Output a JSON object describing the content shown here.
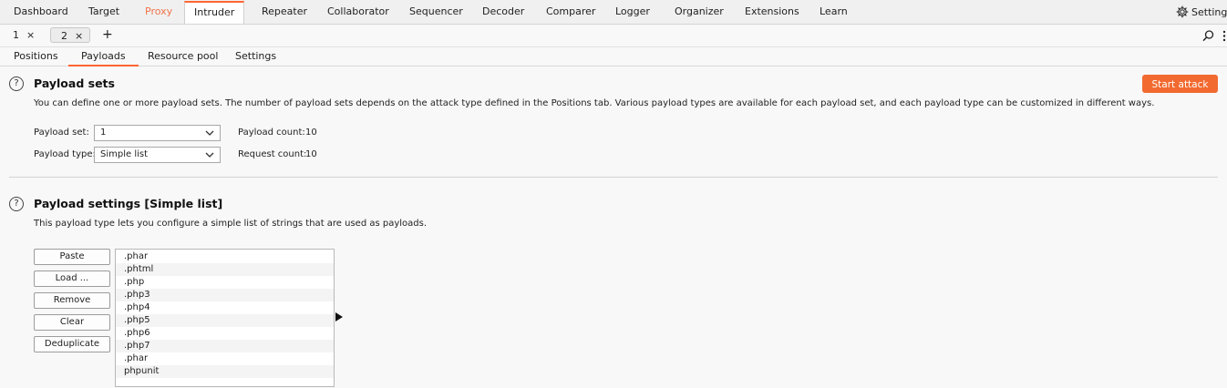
{
  "nav": {
    "tabs": [
      "Dashboard",
      "Target",
      "Proxy",
      "Intruder",
      "Repeater",
      "Collaborator",
      "Sequencer",
      "Decoder",
      "Comparer",
      "Logger",
      "Organizer",
      "Extensions",
      "Learn"
    ],
    "settings_label": "Settings",
    "accent": "#ff6633"
  },
  "instance_tabs": [
    {
      "label": "1",
      "close": "×"
    },
    {
      "label": "2",
      "close": "×"
    }
  ],
  "add_tab": "+",
  "sub_tabs": [
    "Positions",
    "Payloads",
    "Resource pool",
    "Settings"
  ],
  "payload_sets": {
    "title": "Payload sets",
    "description": "You can define one or more payload sets. The number of payload sets depends on the attack type defined in the Positions tab. Various payload types are available for each payload set, and each payload type can be customized in different ways.",
    "start_attack": "Start attack",
    "payload_set_label": "Payload set:",
    "payload_set_value": "1",
    "payload_type_label": "Payload type:",
    "payload_type_value": "Simple list",
    "payload_count_label": "Payload count:",
    "payload_count_value": "10",
    "request_count_label": "Request count:",
    "request_count_value": "10"
  },
  "payload_settings": {
    "title": "Payload settings [Simple list]",
    "description": "This payload type lets you configure a simple list of strings that are used as payloads.",
    "buttons": [
      "Paste",
      "Load ...",
      "Remove",
      "Clear",
      "Deduplicate"
    ],
    "items": [
      ".phar",
      ".phtml",
      ".php",
      ".php3",
      ".php4",
      ".php5",
      ".php6",
      ".php7",
      ".phar",
      "phpunit"
    ]
  }
}
